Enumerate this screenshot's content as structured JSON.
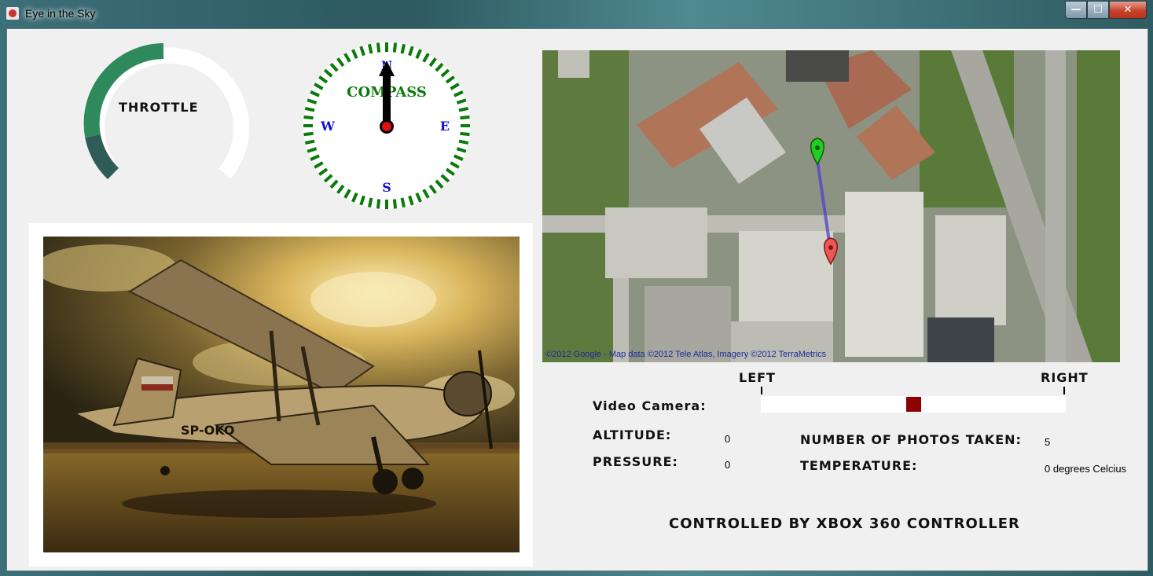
{
  "window": {
    "title": "Eye in the Sky",
    "buttons": {
      "minimize": "—",
      "maximize": "☐",
      "close": "✕"
    }
  },
  "throttle": {
    "label": "THROTTLE",
    "level_percent": 40,
    "fill_color": "#2e8a5a",
    "track_color": "#ffffff"
  },
  "compass": {
    "title": "COMPASS",
    "north": "N",
    "south": "S",
    "east": "E",
    "west": "W",
    "heading_degrees": 0,
    "ring_color": "#0a7a0a"
  },
  "map": {
    "credit": "©2012 Google - Map data ©2012 Tele Atlas, Imagery ©2012 TerraMetrics",
    "start_marker_color": "#22cc22",
    "end_marker_color": "#ee5555"
  },
  "camera": {
    "label": "Video Camera:",
    "left_label": "LEFT",
    "right_label": "RIGHT",
    "position_fraction": 0.5
  },
  "telemetry": {
    "altitude_label": "ALTITUDE:",
    "altitude_value": "0",
    "pressure_label": "PRESSURE:",
    "pressure_value": "0",
    "photos_label": "NUMBER OF PHOTOS TAKEN:",
    "photos_value": "5",
    "temperature_label": "TEMPERATURE:",
    "temperature_value": "0 degrees Celcius"
  },
  "footer": {
    "controller_label": "CONTROLLED BY XBOX 360 CONTROLLER"
  },
  "photo": {
    "tail_text": "SP-OKO"
  }
}
